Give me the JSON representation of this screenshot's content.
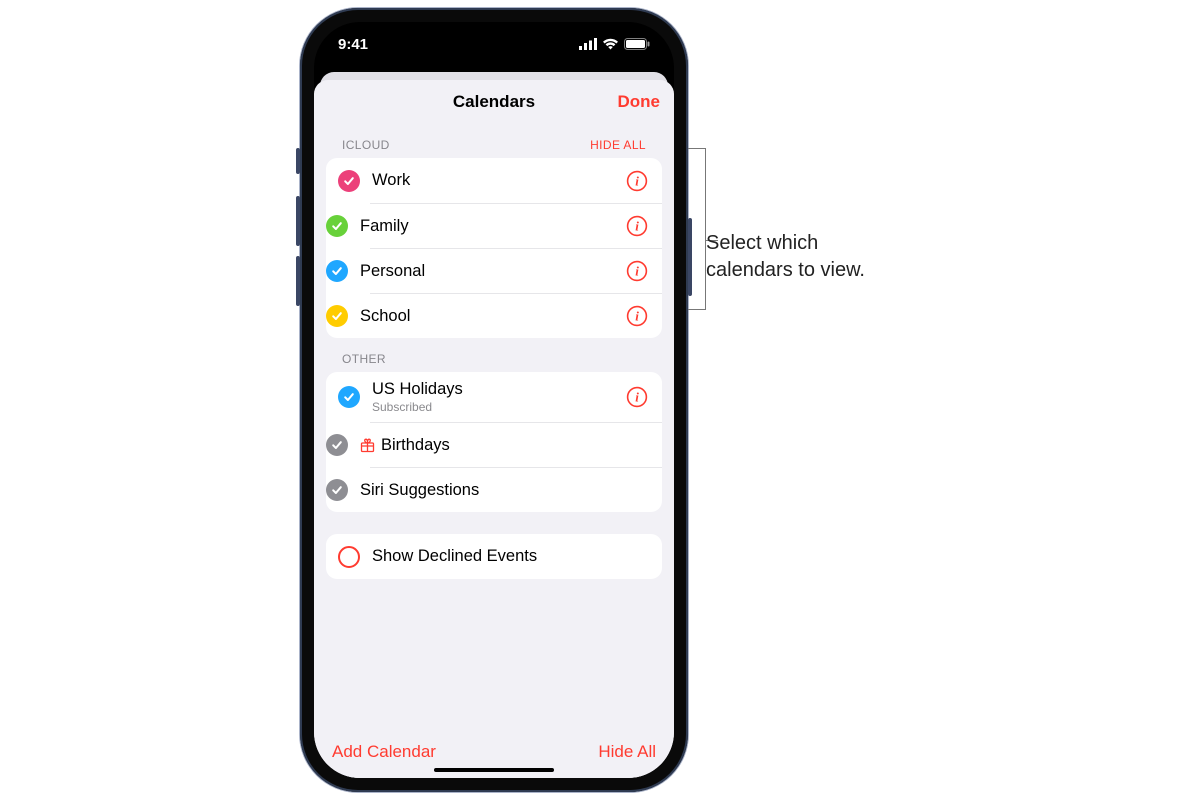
{
  "status": {
    "time": "9:41"
  },
  "header": {
    "title": "Calendars",
    "done": "Done"
  },
  "sections": {
    "icloud": {
      "title": "ICLOUD",
      "action": "HIDE ALL",
      "items": [
        {
          "label": "Work"
        },
        {
          "label": "Family"
        },
        {
          "label": "Personal"
        },
        {
          "label": "School"
        }
      ]
    },
    "other": {
      "title": "OTHER",
      "items": [
        {
          "label": "US Holidays",
          "sub": "Subscribed"
        },
        {
          "label": "Birthdays"
        },
        {
          "label": "Siri Suggestions"
        }
      ]
    }
  },
  "declined": {
    "label": "Show Declined Events"
  },
  "toolbar": {
    "add": "Add Calendar",
    "hide": "Hide All"
  },
  "callout": {
    "line1": "Select which",
    "line2": "calendars to view."
  }
}
